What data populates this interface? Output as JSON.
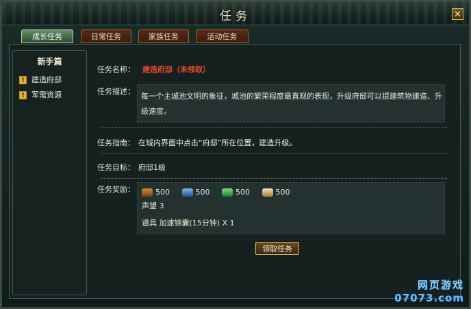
{
  "window": {
    "title": "任务",
    "close_icon": "close-icon"
  },
  "tabs": [
    {
      "label": "成长任务",
      "active": true
    },
    {
      "label": "日常任务",
      "active": false
    },
    {
      "label": "家族任务",
      "active": false
    },
    {
      "label": "活动任务",
      "active": false
    }
  ],
  "sidebar": {
    "heading": "新手篇",
    "items": [
      {
        "label": "建造府邸",
        "icon": "exclamation-icon"
      },
      {
        "label": "军需资源",
        "icon": "exclamation-icon"
      }
    ]
  },
  "quest": {
    "name_label": "任务名称：",
    "name_value": "建造府邸（未领取）",
    "desc_label": "任务描述：",
    "desc_value": "每一个主城池文明的象征，城池的繁荣程度最直观的表现，升级府邸可以提建筑物建造、升级速度。",
    "guide_label": "任务指南：",
    "guide_value": "在城内界面中点击“府邸”所在位置，建造升级。",
    "goal_label": "任务目标：",
    "goal_value": "府邸1级",
    "reward_label": "任务奖励：",
    "rewards": [
      {
        "icon": "wood-icon",
        "amount": "500"
      },
      {
        "icon": "ore-icon",
        "amount": "500"
      },
      {
        "icon": "food-icon",
        "amount": "500"
      },
      {
        "icon": "silver-icon",
        "amount": "500"
      }
    ],
    "reputation": "声望 3",
    "item_reward": "道具 加速锦囊(15分钟) X 1",
    "accept_button": "领取任务"
  },
  "watermark": {
    "line1": "网页游戏",
    "line2": "07073.com"
  },
  "colors": {
    "accent_red": "#e24b2b",
    "gold": "#d0b36a"
  }
}
